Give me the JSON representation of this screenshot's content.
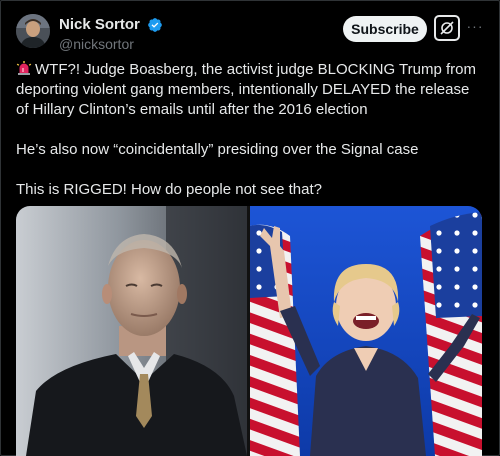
{
  "author": {
    "display_name": "Nick Sortor",
    "handle": "@nicksortor",
    "verified": true,
    "avatar_icon": "user-avatar"
  },
  "actions": {
    "subscribe_label": "Subscribe",
    "grok_icon": "grok-icon",
    "more_icon": "more-icon",
    "more_glyph": "···"
  },
  "tweet": {
    "lead_icon": "siren-icon",
    "paragraphs": [
      "WTF?! Judge Boasberg, the activist judge BLOCKING Trump from deporting violent gang members, intentionally DELAYED the release of Hillary Clinton’s emails until after the 2016 election",
      "He’s also now “coincidentally” presiding over the Signal case",
      "This is RIGGED! How do people not see that?"
    ]
  },
  "media": {
    "images": [
      {
        "name": "judge-photo"
      },
      {
        "name": "hillary-photo"
      }
    ]
  },
  "colors": {
    "background": "#000000",
    "text": "#e7e9ea",
    "secondary": "#71767b",
    "verified_blue": "#1d9bf0",
    "subscribe_bg": "#eff3f4"
  }
}
